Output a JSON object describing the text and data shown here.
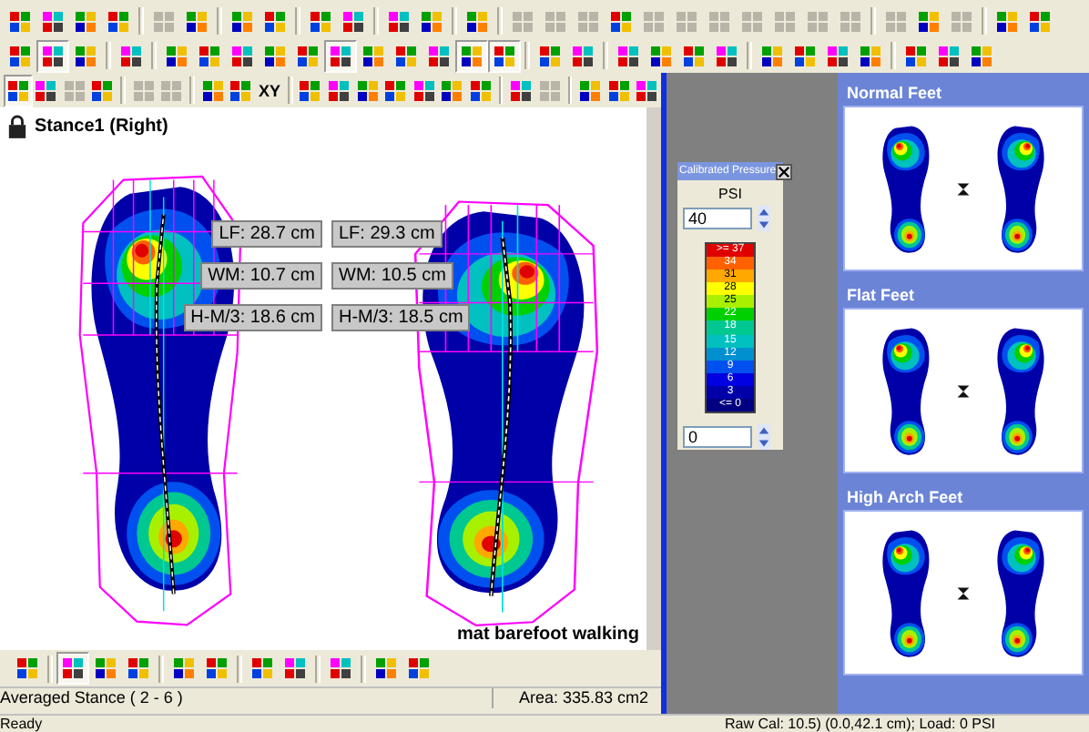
{
  "toolbars": [
    [
      [
        {
          "disabled": false,
          "pressed": false
        },
        {
          "disabled": false,
          "pressed": false
        },
        {
          "disabled": false,
          "pressed": false
        },
        {
          "disabled": false,
          "pressed": false
        }
      ],
      [
        {
          "disabled": true,
          "pressed": false
        },
        {
          "disabled": false,
          "pressed": false
        }
      ],
      [
        {
          "disabled": false,
          "pressed": false
        },
        {
          "disabled": false,
          "pressed": false
        }
      ],
      [
        {
          "disabled": false,
          "pressed": false
        },
        {
          "disabled": false,
          "pressed": false
        }
      ],
      [
        {
          "disabled": false,
          "pressed": false
        },
        {
          "disabled": false,
          "pressed": false
        }
      ],
      [
        {
          "disabled": false,
          "pressed": false
        }
      ],
      [
        {
          "disabled": true,
          "pressed": false
        },
        {
          "disabled": true,
          "pressed": false
        },
        {
          "disabled": true,
          "pressed": false
        },
        {
          "disabled": false,
          "pressed": false
        },
        {
          "disabled": true,
          "pressed": false
        },
        {
          "disabled": true,
          "pressed": false
        },
        {
          "disabled": true,
          "pressed": false
        },
        {
          "disabled": true,
          "pressed": false
        },
        {
          "disabled": true,
          "pressed": false
        },
        {
          "disabled": true,
          "pressed": false
        },
        {
          "disabled": true,
          "pressed": false
        }
      ],
      [
        {
          "disabled": true,
          "pressed": false
        },
        {
          "disabled": false,
          "pressed": false
        },
        {
          "disabled": true,
          "pressed": false
        }
      ],
      [
        {
          "disabled": false,
          "pressed": false
        },
        {
          "disabled": false,
          "pressed": false
        }
      ]
    ],
    [
      [
        {
          "disabled": false,
          "pressed": false
        },
        {
          "disabled": false,
          "pressed": true
        },
        {
          "disabled": false,
          "pressed": false
        }
      ],
      [
        {
          "disabled": false,
          "pressed": false
        }
      ],
      [
        {
          "disabled": false,
          "pressed": false
        },
        {
          "disabled": false,
          "pressed": false
        },
        {
          "disabled": false,
          "pressed": false
        },
        {
          "disabled": false,
          "pressed": false
        },
        {
          "disabled": false,
          "pressed": false
        },
        {
          "disabled": false,
          "pressed": true
        },
        {
          "disabled": false,
          "pressed": false
        },
        {
          "disabled": false,
          "pressed": false
        },
        {
          "disabled": false,
          "pressed": false
        },
        {
          "disabled": false,
          "pressed": true
        },
        {
          "disabled": false,
          "pressed": true
        }
      ],
      [
        {
          "disabled": false,
          "pressed": false
        },
        {
          "disabled": false,
          "pressed": false
        }
      ],
      [
        {
          "disabled": false,
          "pressed": false
        },
        {
          "disabled": false,
          "pressed": false
        },
        {
          "disabled": false,
          "pressed": false
        },
        {
          "disabled": false,
          "pressed": false
        }
      ],
      [
        {
          "disabled": false,
          "pressed": false
        },
        {
          "disabled": false,
          "pressed": false
        },
        {
          "disabled": false,
          "pressed": false
        },
        {
          "disabled": false,
          "pressed": false
        }
      ],
      [
        {
          "disabled": false,
          "pressed": false
        },
        {
          "disabled": false,
          "pressed": false
        },
        {
          "disabled": false,
          "pressed": false
        }
      ]
    ],
    [
      [
        {
          "disabled": false,
          "pressed": true
        },
        {
          "disabled": false,
          "pressed": false
        },
        {
          "disabled": true,
          "pressed": false
        },
        {
          "disabled": false,
          "pressed": false
        }
      ],
      [
        {
          "disabled": true,
          "pressed": false
        },
        {
          "disabled": true,
          "pressed": false
        }
      ],
      [
        {
          "disabled": false,
          "pressed": false
        },
        {
          "disabled": false,
          "pressed": false
        },
        {
          "label": "XY",
          "disabled": false,
          "pressed": false
        }
      ],
      [
        {
          "disabled": false,
          "pressed": false
        },
        {
          "disabled": false,
          "pressed": false
        },
        {
          "disabled": false,
          "pressed": false
        },
        {
          "disabled": false,
          "pressed": false
        },
        {
          "disabled": false,
          "pressed": false
        },
        {
          "disabled": false,
          "pressed": false
        },
        {
          "disabled": false,
          "pressed": false
        }
      ],
      [
        {
          "disabled": false,
          "pressed": false
        },
        {
          "disabled": true,
          "pressed": false
        }
      ],
      [
        {
          "disabled": false,
          "pressed": false
        },
        {
          "disabled": false,
          "pressed": false
        },
        {
          "disabled": false,
          "pressed": false
        }
      ]
    ]
  ],
  "view": {
    "title": "Stance1 (Right)",
    "measurements": [
      {
        "left": "LF: 28.7 cm",
        "right": "LF: 29.3 cm"
      },
      {
        "left": "WM: 10.7 cm",
        "right": "WM: 10.5 cm"
      },
      {
        "left": "H-M/3: 18.6 cm",
        "right": "H-M/3: 18.5 cm"
      }
    ],
    "caption": "mat barefoot walking"
  },
  "bottom_toolbar": [
    [
      {
        "disabled": false,
        "pressed": false
      }
    ],
    [
      {
        "disabled": false,
        "pressed": true
      },
      {
        "disabled": false,
        "pressed": false
      },
      {
        "disabled": false,
        "pressed": false
      }
    ],
    [
      {
        "disabled": false,
        "pressed": false
      },
      {
        "disabled": false,
        "pressed": false
      }
    ],
    [
      {
        "disabled": false,
        "pressed": false
      },
      {
        "disabled": false,
        "pressed": false
      }
    ],
    [
      {
        "disabled": false,
        "pressed": false
      }
    ],
    [
      {
        "disabled": false,
        "pressed": false
      },
      {
        "disabled": false,
        "pressed": false
      }
    ]
  ],
  "view_status": [
    "Averaged Stance ( 2 - 6 )",
    "Area: 335.83 cm2"
  ],
  "legend": {
    "title": "Calibrated Pressure",
    "unit": "PSI",
    "max": "40",
    "min": "0",
    "levels": [
      {
        "label": ">= 37",
        "color": "#e00000"
      },
      {
        "label": "34",
        "color": "#ff6000"
      },
      {
        "label": "31",
        "color": "#ffa800"
      },
      {
        "label": "28",
        "color": "#ffff00"
      },
      {
        "label": "25",
        "color": "#a8f000"
      },
      {
        "label": "22",
        "color": "#00d000"
      },
      {
        "label": "18",
        "color": "#00c890"
      },
      {
        "label": "15",
        "color": "#00c0c0"
      },
      {
        "label": "12",
        "color": "#0090d0"
      },
      {
        "label": "9",
        "color": "#0050f0"
      },
      {
        "label": "6",
        "color": "#0000e0"
      },
      {
        "label": "3",
        "color": "#0000a8"
      },
      {
        "label": "<= 0",
        "color": "#000080"
      }
    ]
  },
  "examples": [
    {
      "title": "Normal Feet"
    },
    {
      "title": "Flat Feet"
    },
    {
      "title": "High Arch Feet"
    }
  ],
  "status_bar": [
    "Ready",
    "Raw Cal: 10.5) (0.0,42.1 cm); Load: 0 PSI"
  ]
}
